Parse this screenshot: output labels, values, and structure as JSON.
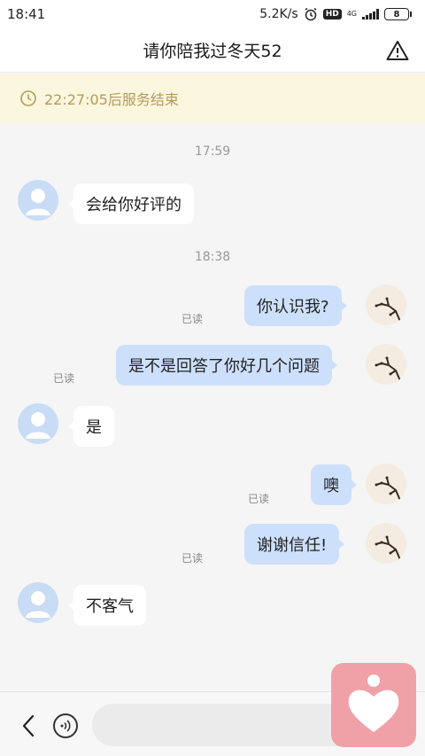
{
  "status_bar": {
    "time": "18:41",
    "net_speed": "5.2K/s",
    "hd_badge": "HD",
    "net_type": "4G",
    "battery": "8"
  },
  "nav": {
    "title": "请你陪我过冬天52"
  },
  "notice": {
    "text": "22:27:05后服务结束"
  },
  "chat": {
    "time_1": "17:59",
    "time_2": "18:38",
    "messages": [
      {
        "side": "in",
        "text": "会给你好评的"
      },
      {
        "side": "out",
        "text": "你认识我?",
        "read": "已读"
      },
      {
        "side": "out",
        "text": "是不是回答了你好几个问题",
        "read": "已读"
      },
      {
        "side": "in",
        "text": "是"
      },
      {
        "side": "out",
        "text": "噢",
        "read": "已读"
      },
      {
        "side": "out",
        "text": "谢谢信任!",
        "read": "已读"
      },
      {
        "side": "in",
        "text": "不客气"
      }
    ]
  },
  "input": {
    "placeholder": ""
  },
  "colors": {
    "accent_bubble": "#cde0fb",
    "notice_bg": "#fbf6de",
    "notice_text": "#b49a5a",
    "badge": "#f0a1a7"
  }
}
